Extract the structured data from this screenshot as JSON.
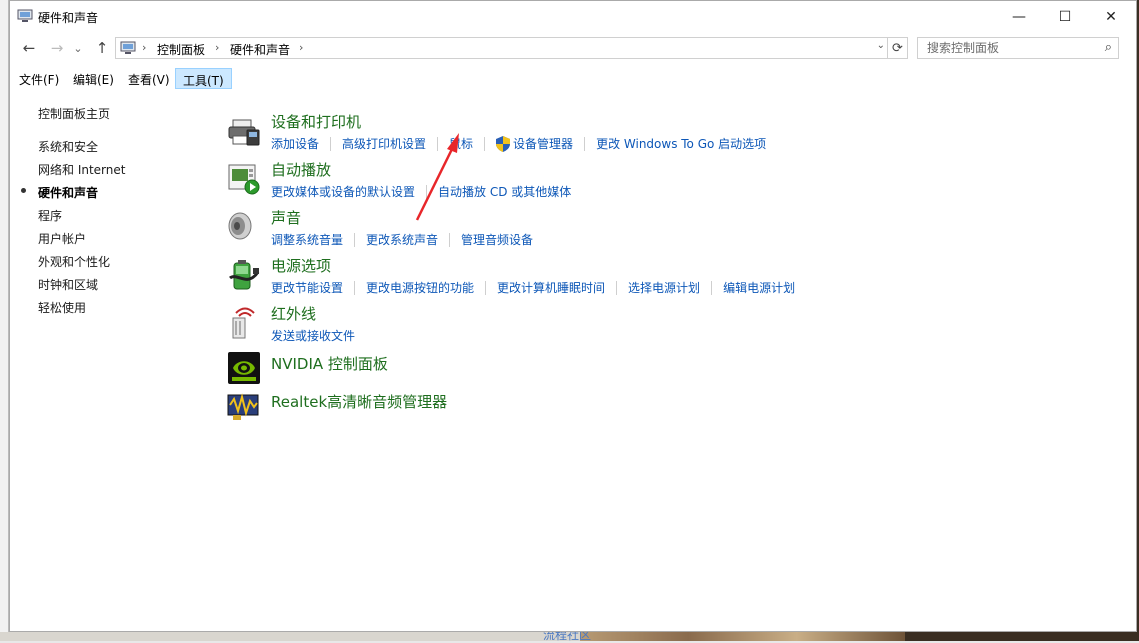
{
  "window": {
    "title": "硬件和声音"
  },
  "titlebar": {
    "min": "—",
    "max": "☐",
    "close": "✕"
  },
  "nav": {
    "back": "←",
    "forward": "→",
    "recent": "⌄",
    "up": "↑"
  },
  "address": {
    "crumbs": [
      "控制面板",
      "硬件和声音"
    ],
    "separator": "›"
  },
  "search": {
    "placeholder": "搜索控制面板"
  },
  "menubar": {
    "items": [
      "文件(F)",
      "编辑(E)",
      "查看(V)",
      "工具(T)"
    ],
    "active_index": 3
  },
  "sidebar": {
    "items": [
      "控制面板主页",
      "系统和安全",
      "网络和 Internet",
      "硬件和声音",
      "程序",
      "用户帐户",
      "外观和个性化",
      "时钟和区域",
      "轻松使用"
    ],
    "current_index": 3
  },
  "categories": [
    {
      "icon": "printer-icon",
      "title": "设备和打印机",
      "links": [
        "添加设备",
        "高级打印机设置",
        "鼠标",
        "设备管理器",
        "更改 Windows To Go 启动选项"
      ]
    },
    {
      "icon": "autoplay-icon",
      "title": "自动播放",
      "links": [
        "更改媒体或设备的默认设置",
        "自动播放 CD 或其他媒体"
      ]
    },
    {
      "icon": "speaker-icon",
      "title": "声音",
      "links": [
        "调整系统音量",
        "更改系统声音",
        "管理音频设备"
      ]
    },
    {
      "icon": "battery-icon",
      "title": "电源选项",
      "links": [
        "更改节能设置",
        "更改电源按钮的功能",
        "更改计算机睡眠时间",
        "选择电源计划",
        "编辑电源计划"
      ]
    },
    {
      "icon": "infrared-icon",
      "title": "红外线",
      "links": [
        "发送或接收文件"
      ]
    },
    {
      "icon": "nvidia-icon",
      "title": "NVIDIA 控制面板",
      "links": []
    },
    {
      "icon": "realtek-icon",
      "title": "Realtek高清晰音频管理器",
      "links": []
    }
  ],
  "background": {
    "taskbar_text": "流程社区"
  },
  "colors": {
    "link": "#0d57b7",
    "heading": "#1e6e1e",
    "menu_active": "#cce8ff",
    "annotation_arrow": "#e8262a"
  }
}
